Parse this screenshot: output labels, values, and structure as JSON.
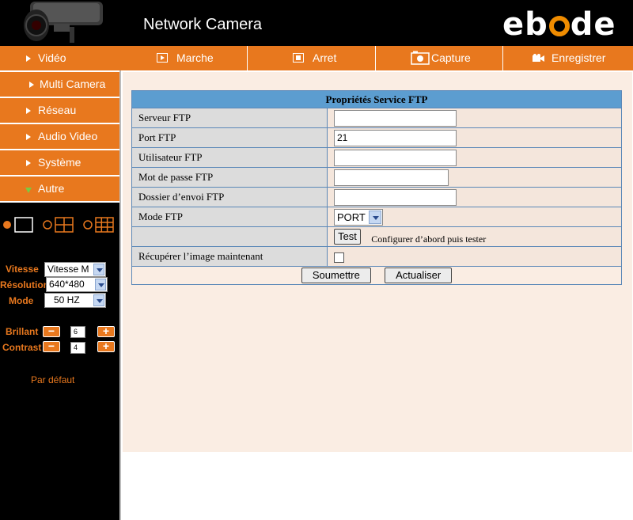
{
  "header": {
    "app_title": "Network Camera",
    "brand": {
      "prefix": "eb",
      "o": "o",
      "suffix": "de"
    }
  },
  "sidebar": {
    "items": [
      {
        "label": "Vidéo",
        "icon": "triangle-right-icon"
      },
      {
        "label": "Multi Camera",
        "icon": "triangle-right-icon"
      },
      {
        "label": "Réseau",
        "icon": "triangle-right-icon"
      },
      {
        "label": "Audio Video",
        "icon": "triangle-right-icon"
      },
      {
        "label": "Système",
        "icon": "triangle-right-icon"
      },
      {
        "label": "Autre",
        "icon": "triangle-down-icon"
      }
    ],
    "controls": {
      "vitesse_label": "Vitesse",
      "vitesse_value": "Vitesse M",
      "resolution_label": "Résolution",
      "resolution_value": "640*480",
      "mode_label": "Mode",
      "mode_value": "50 HZ",
      "brillant_label": "Brillant",
      "brillant_value": "6",
      "contrast_label": "Contrast",
      "contrast_value": "4",
      "default_link": "Par défaut"
    }
  },
  "toolbar": {
    "play": "Marche",
    "stop": "Arret",
    "capture": "Capture",
    "record": "Enregistrer"
  },
  "ftp": {
    "title": "Propriétés Service FTP",
    "server_label": "Serveur FTP",
    "server_value": "",
    "port_label": "Port FTP",
    "port_value": "21",
    "user_label": "Utilisateur FTP",
    "user_value": "",
    "password_label": "Mot de passe FTP",
    "password_value": "",
    "folder_label": "Dossier d’envoi FTP",
    "folder_value": "",
    "mode_label": "Mode FTP",
    "mode_value": "PORT",
    "test_button": "Test",
    "test_hint": "Configurer d’abord puis tester",
    "grab_label": "Récupérer l’image maintenant",
    "submit_button": "Soumettre",
    "refresh_button": "Actualiser"
  },
  "colors": {
    "accent": "#e8781e",
    "table_header": "#5c9dd0",
    "panel_bg": "#faede3"
  }
}
